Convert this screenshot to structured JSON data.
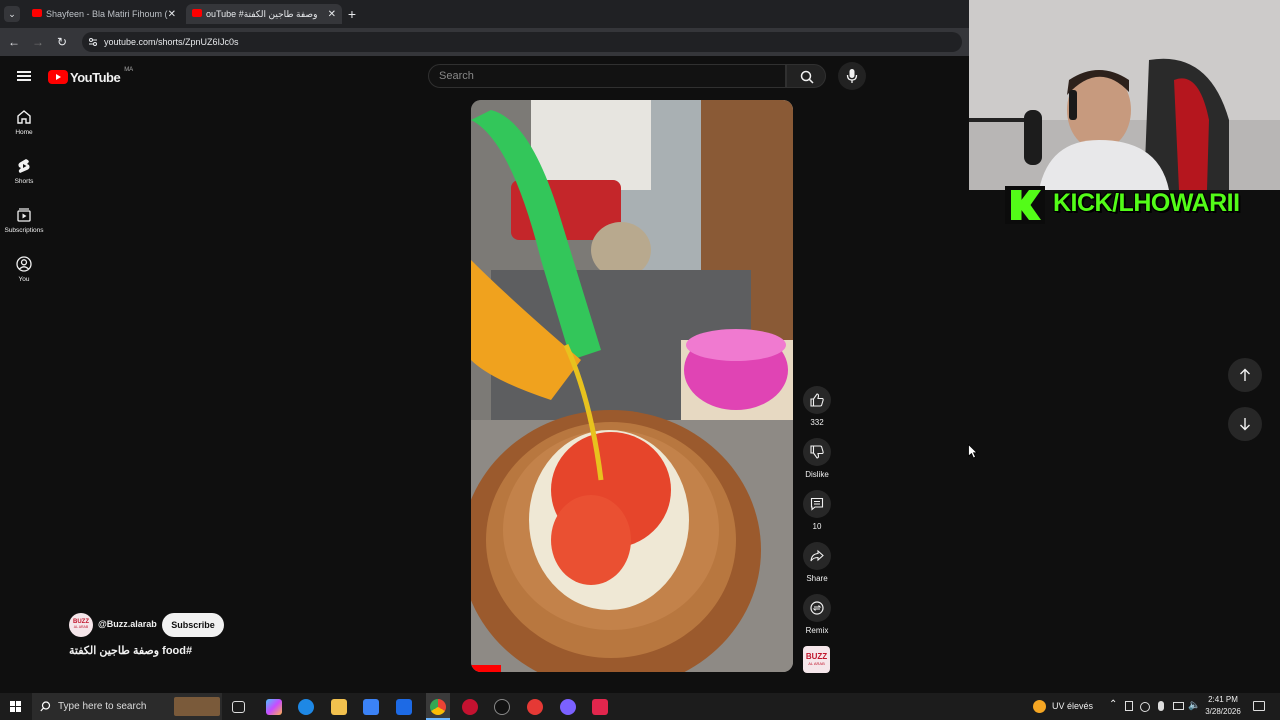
{
  "browser": {
    "tabs": [
      {
        "title": "Shayfeen - Bla Matiri Fihoum (",
        "active": false
      },
      {
        "title": "ouTube #وصفة طاجين الكفتة",
        "active": true
      }
    ],
    "new_tab": "+",
    "close": "✕",
    "url": "youtube.com/shorts/ZpnUZ6IJc0s"
  },
  "youtube": {
    "logo_text": "YouTube",
    "country": "MA",
    "search_placeholder": "Search",
    "sidebar": [
      {
        "label": "Home",
        "icon": "home-icon"
      },
      {
        "label": "Shorts",
        "icon": "shorts-icon"
      },
      {
        "label": "Subscriptions",
        "icon": "subscriptions-icon"
      },
      {
        "label": "You",
        "icon": "you-icon"
      }
    ],
    "actions": {
      "like_count": "332",
      "dislike_label": "Dislike",
      "comment_count": "10",
      "share_label": "Share",
      "remix_label": "Remix"
    },
    "channel": {
      "handle": "@Buzz.alarab",
      "avatar_text": "BUZZ",
      "avatar_sub": "AL ARAB",
      "subscribe_label": "Subscribe"
    },
    "video_title": "#food وصفة طاجين الكفتة",
    "accent_color": "#ff0000"
  },
  "overlay": {
    "kick_text": "KICK/LHOWARII",
    "kick_color": "#53fc18"
  },
  "taskbar": {
    "search_placeholder": "Type here to search",
    "weather": "UV élevés",
    "time": "2:41 PM",
    "date": "3/28/2026"
  }
}
